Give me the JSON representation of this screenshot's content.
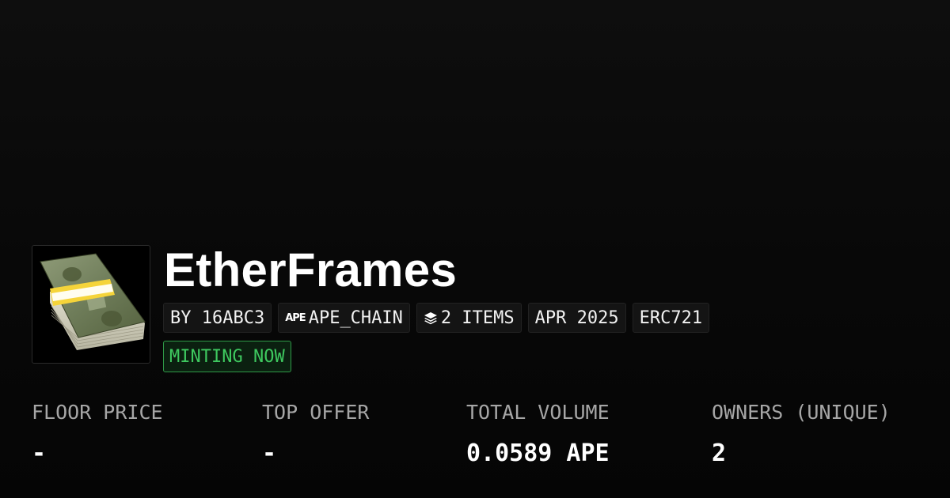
{
  "collection": {
    "name": "EtherFrames",
    "thumbnail_icon": "cash-stack-icon"
  },
  "chips": {
    "creator": "BY 16ABC3",
    "chain_icon_text": "APE",
    "chain": "APE_CHAIN",
    "items_icon": "layers-icon",
    "items": "2 ITEMS",
    "date": "APR 2025",
    "standard": "ERC721"
  },
  "status": {
    "label": "MINTING NOW",
    "color": "#3ec85f"
  },
  "stats": {
    "floor_price": {
      "label": "FLOOR PRICE",
      "value": "-"
    },
    "top_offer": {
      "label": "TOP OFFER",
      "value": "-"
    },
    "total_volume": {
      "label": "TOTAL VOLUME",
      "value": "0.0589 APE"
    },
    "owners": {
      "label": "OWNERS (UNIQUE)",
      "value": "2"
    }
  }
}
